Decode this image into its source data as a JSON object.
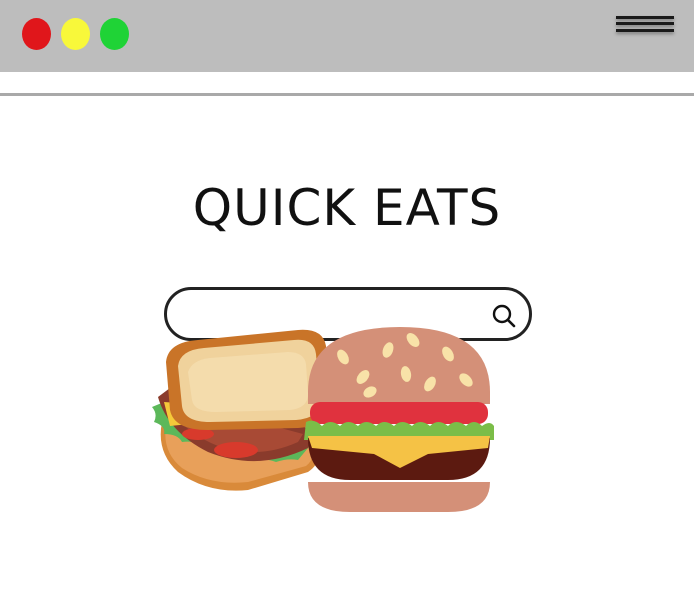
{
  "window": {
    "controls": [
      "close",
      "minimize",
      "maximize"
    ],
    "control_colors": {
      "close": "#e0161b",
      "minimize": "#f8f83a",
      "maximize": "#1fd336"
    },
    "titlebar_color": "#bdbdbd"
  },
  "header": {
    "menu_icon": "hamburger-menu-icon"
  },
  "main": {
    "title": "QUICK EATS",
    "search": {
      "value": "",
      "placeholder": "",
      "icon": "search-icon"
    },
    "hero_image": {
      "items": [
        "sandwich-icon",
        "burger-icon"
      ]
    }
  }
}
